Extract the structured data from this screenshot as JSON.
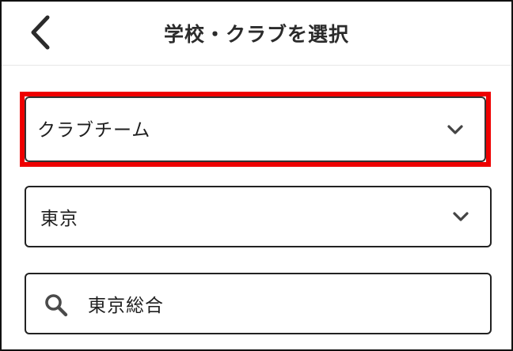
{
  "header": {
    "title": "学校・クラブを選択",
    "back_icon": "chevron-left-icon"
  },
  "form": {
    "type_select": {
      "value": "クラブチーム",
      "icon": "chevron-down-icon",
      "highlight_color": "#ee0000"
    },
    "prefecture_select": {
      "value": "東京",
      "icon": "chevron-down-icon"
    },
    "search": {
      "value": "東京総合",
      "icon": "search-icon"
    }
  }
}
